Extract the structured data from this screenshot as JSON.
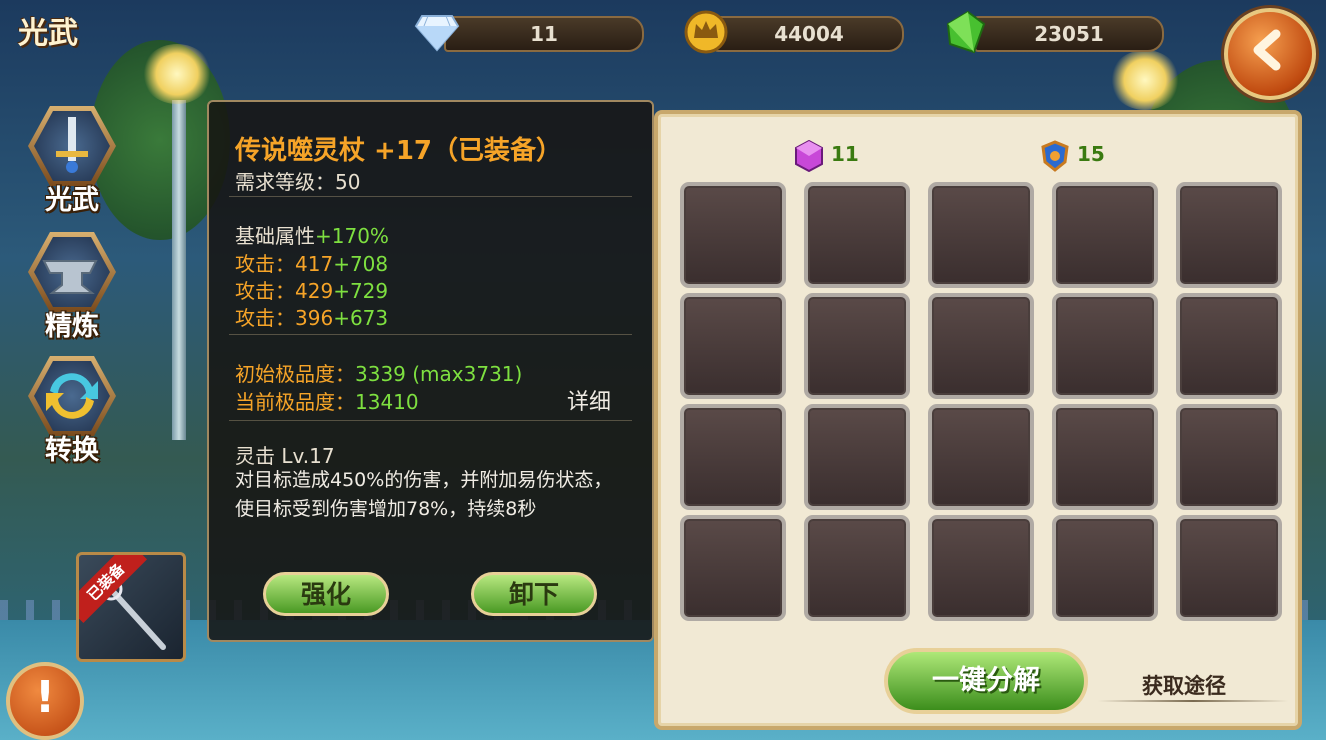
{
  "header": {
    "title": "光武",
    "resources": [
      {
        "icon": "diamond-icon",
        "value": "11"
      },
      {
        "icon": "crown-coin-icon",
        "value": "44004"
      },
      {
        "icon": "green-crystal-icon",
        "value": "23051"
      }
    ]
  },
  "nav": {
    "items": [
      {
        "icon": "sword-emblem-icon",
        "label": "光武"
      },
      {
        "icon": "anvil-icon",
        "label": "精炼"
      },
      {
        "icon": "swap-arrows-icon",
        "label": "转换"
      }
    ],
    "warn_symbol": "!"
  },
  "equipped_slot": {
    "badge": "已装备"
  },
  "tooltip": {
    "name": "传说噬灵杖 +17（已装备）",
    "level_req": "需求等级：50",
    "base_attr_label": "基础属性",
    "base_attr_bonus": "+170%",
    "attacks": [
      {
        "label": "攻击：",
        "base": "417",
        "bonus": "+708"
      },
      {
        "label": "攻击：",
        "base": "429",
        "bonus": "+729"
      },
      {
        "label": "攻击：",
        "base": "396",
        "bonus": "+673"
      }
    ],
    "initial_quality_label": "初始极品度：",
    "initial_quality_value": "3339 (max3731)",
    "current_quality_label": "当前极品度：",
    "current_quality_value": "13410",
    "detail_link": "详细",
    "skill_name": "灵击 Lv.17",
    "skill_desc": "对目标造成450%的伤害，并附加易伤状态，使目标受到伤害增加78%，持续8秒",
    "buttons": {
      "enhance": "强化",
      "unequip": "卸下"
    }
  },
  "inventory": {
    "currencies": [
      {
        "icon": "purple-gem-icon",
        "value": "11"
      },
      {
        "icon": "blue-shield-icon",
        "value": "15"
      }
    ],
    "rows": 4,
    "cols": 5,
    "decompose_button": "一键分解",
    "source_link": "获取途径"
  }
}
